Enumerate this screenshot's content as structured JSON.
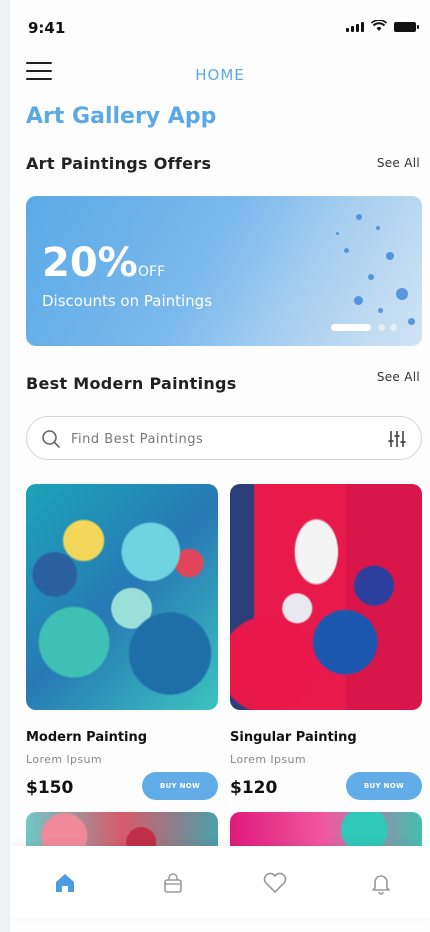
{
  "status_bar": {
    "time": "9:41"
  },
  "header": {
    "title": "HOME",
    "app_title": "Art Gallery App"
  },
  "offers": {
    "title": "Art Paintings Offers",
    "see_all": "See All"
  },
  "banner": {
    "percent": "20%",
    "off": "OFF",
    "text": "Discounts on Paintings"
  },
  "modern": {
    "title": "Best Modern Paintings",
    "see_all": "See All"
  },
  "search": {
    "placeholder": "Find Best Paintings",
    "value": ""
  },
  "paintings": [
    {
      "name": "Modern Painting",
      "subtitle": "Lorem Ipsum",
      "price": "$150",
      "button": "BUY NOW"
    },
    {
      "name": "Singular Painting",
      "subtitle": "Lorem Ipsum",
      "price": "$120",
      "button": "BUY NOW"
    }
  ],
  "nav": {
    "items": [
      "home-icon",
      "bag-icon",
      "heart-icon",
      "bell-icon"
    ],
    "active": "home-icon"
  },
  "colors": {
    "accent": "#5aa9e6",
    "button": "#62ace8",
    "text": "#222222"
  }
}
